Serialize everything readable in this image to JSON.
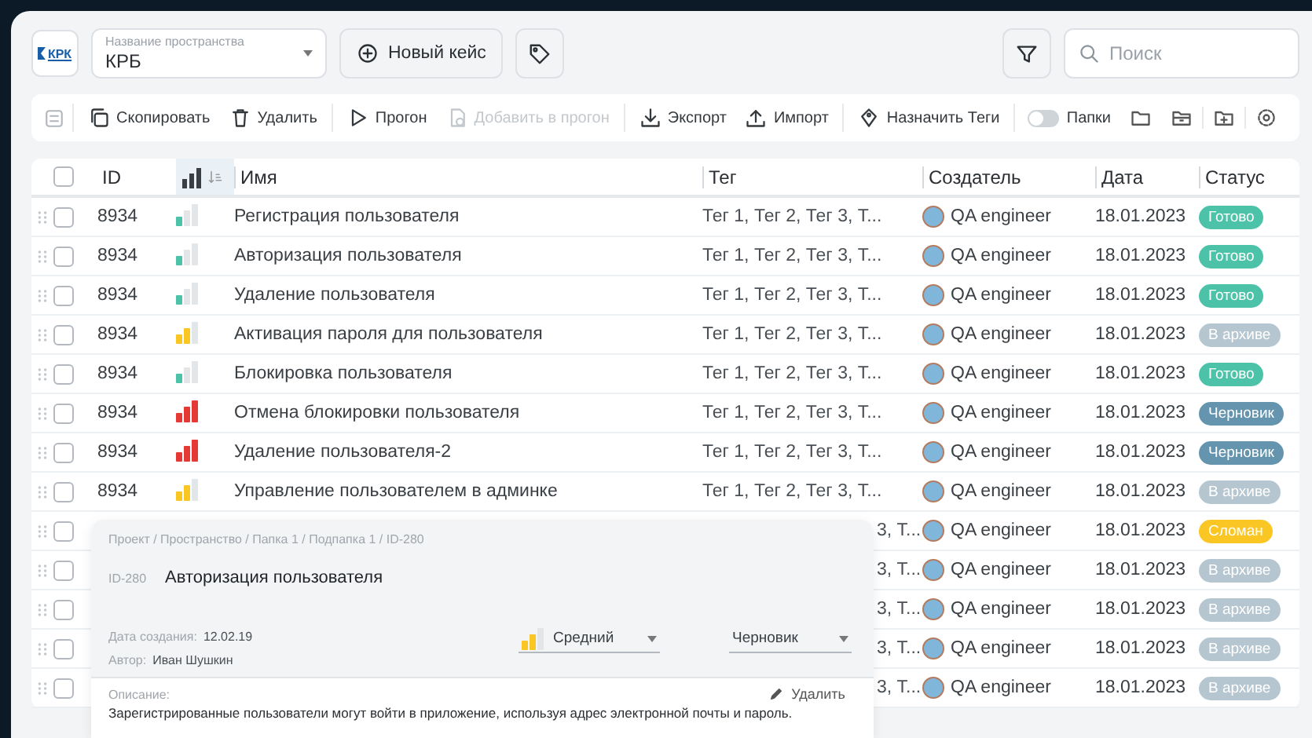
{
  "header": {
    "logo_text": "КРК",
    "space_select": {
      "label": "Название пространства",
      "value": "КРБ"
    },
    "new_case_button": "Новый кейс",
    "search": {
      "placeholder": "Поиск"
    }
  },
  "toolbar": {
    "groups": [
      [
        {
          "label": "Скопировать",
          "disabled": false
        },
        {
          "label": "Удалить",
          "disabled": false
        }
      ],
      [
        {
          "label": "Прогон",
          "disabled": false
        },
        {
          "label": "Добавить в прогон",
          "disabled": true
        }
      ],
      [
        {
          "label": "Экспорт",
          "disabled": false
        },
        {
          "label": "Импорт",
          "disabled": false
        }
      ],
      [
        {
          "label": "Назначить Теги",
          "disabled": false
        }
      ]
    ],
    "folders_toggle": {
      "label": "Папки",
      "on": false
    }
  },
  "table": {
    "header_checked": false,
    "columns": [
      "ID",
      "Имя",
      "Тег",
      "Создатель",
      "Дата",
      "Статус"
    ],
    "rows": [
      {
        "checked": false,
        "id": "8934",
        "priority_bars": {
          "level": 0.33
        },
        "name": "Регистрация пользователя",
        "tag": "Тег 1, Тег 2, Тег 3, Т...",
        "creator": "QA engineer",
        "date": "18.01.2023",
        "status": {
          "label": "Готово",
          "kind": "done"
        }
      },
      {
        "checked": false,
        "id": "8934",
        "priority_bars": {
          "level": 0.33
        },
        "name": "Авторизация пользователя",
        "tag": "Тег 1, Тег 2, Тег 3, Т...",
        "creator": "QA engineer",
        "date": "18.01.2023",
        "status": {
          "label": "Готово",
          "kind": "done"
        }
      },
      {
        "checked": false,
        "id": "8934",
        "priority_bars": {
          "level": 0.33
        },
        "name": "Удаление пользователя",
        "tag": "Тег 1, Тег 2, Тег 3, Т...",
        "creator": "QA engineer",
        "date": "18.01.2023",
        "status": {
          "label": "Готово",
          "kind": "done"
        }
      },
      {
        "checked": false,
        "id": "8934",
        "priority_bars": {
          "level": 0.67
        },
        "name": "Активация пароля для пользователя",
        "tag": "Тег 1, Тег 2, Тег 3, Т...",
        "creator": "QA engineer",
        "date": "18.01.2023",
        "status": {
          "label": "В архиве",
          "kind": "archived"
        }
      },
      {
        "checked": false,
        "id": "8934",
        "priority_bars": {
          "level": 0.33
        },
        "name": "Блокировка пользователя",
        "tag": "Тег 1, Тег 2, Тег 3, Т...",
        "creator": "QA engineer",
        "date": "18.01.2023",
        "status": {
          "label": "Готово",
          "kind": "done"
        }
      },
      {
        "checked": false,
        "id": "8934",
        "priority_bars": {
          "level": 1
        },
        "name": "Отмена блокировки пользователя",
        "tag": "Тег 1, Тег 2, Тег 3, Т...",
        "creator": "QA engineer",
        "date": "18.01.2023",
        "status": {
          "label": "Черновик",
          "kind": "draft"
        }
      },
      {
        "checked": false,
        "id": "8934",
        "priority_bars": {
          "level": 1
        },
        "name": "Удаление пользователя-2",
        "tag": "Тег 1, Тег 2, Тег 3, Т...",
        "creator": "QA engineer",
        "date": "18.01.2023",
        "status": {
          "label": "Черновик",
          "kind": "draft"
        }
      },
      {
        "checked": false,
        "id": "8934",
        "priority_bars": {
          "level": 0.67
        },
        "name": "Управление пользователем в админке",
        "tag": "Тег 1, Тег 2, Тег 3, Т...",
        "creator": "QA engineer",
        "date": "18.01.2023",
        "status": {
          "label": "В архиве",
          "kind": "archived"
        }
      },
      {
        "checked": false,
        "tag": "3, Т...",
        "creator": "QA engineer",
        "date": "18.01.2023",
        "status": {
          "label": "Сломан",
          "kind": "broken"
        }
      },
      {
        "checked": false,
        "tag": "3, Т...",
        "creator": "QA engineer",
        "date": "18.01.2023",
        "status": {
          "label": "В архиве",
          "kind": "archived"
        }
      },
      {
        "checked": false,
        "tag": "3, Т...",
        "creator": "QA engineer",
        "date": "18.01.2023",
        "status": {
          "label": "В архиве",
          "kind": "archived"
        }
      },
      {
        "checked": false,
        "tag": "3, Т...",
        "creator": "QA engineer",
        "date": "18.01.2023",
        "status": {
          "label": "В архиве",
          "kind": "archived"
        }
      },
      {
        "checked": false,
        "tag": "3, Т...",
        "creator": "QA engineer",
        "date": "18.01.2023",
        "status": {
          "label": "В архиве",
          "kind": "archived"
        }
      }
    ]
  },
  "detail": {
    "breadcrumb": "Проект / Пространство / Папка 1 / Подпапка 1 / ID-280",
    "id": "ID-280",
    "title": "Авторизация пользователя",
    "created_label": "Дата создания:",
    "created": "12.02.19",
    "author_label": "Автор:",
    "author": "Иван Шушкин",
    "priority": {
      "value": "Средний",
      "level": 0.67
    },
    "status": "Черновик",
    "description_label": "Описание:",
    "delete_button": "Удалить",
    "description": "Зарегистрированные пользователи могут войти в приложение, используя адрес электронной почты и пароль."
  }
}
